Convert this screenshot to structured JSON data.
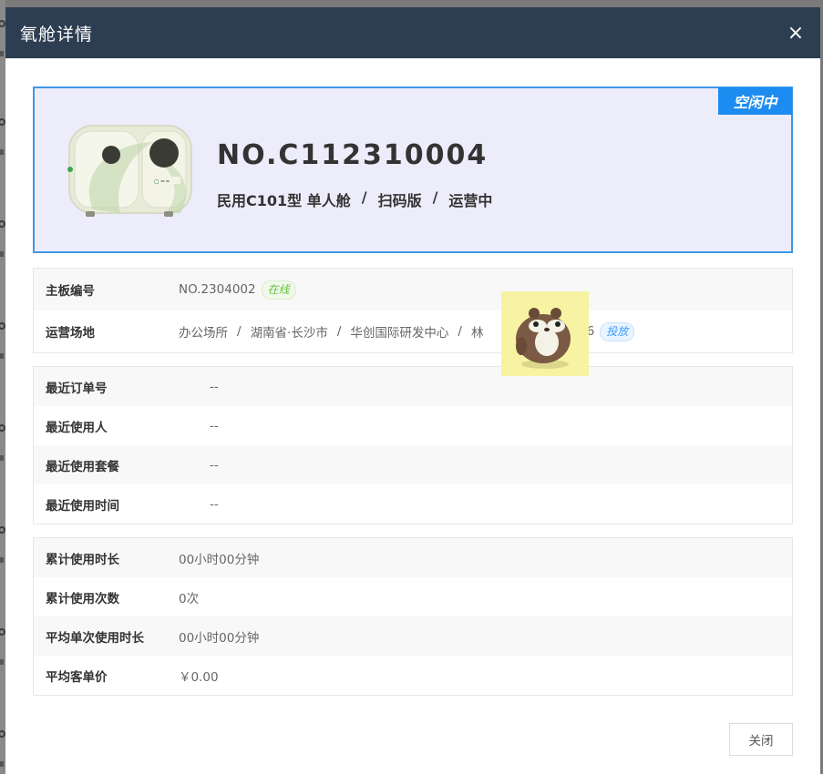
{
  "modal": {
    "title": "氧舱详情",
    "close_glyph": "×"
  },
  "hero": {
    "status_badge": "空闲中",
    "device_no": "NO.C112310004",
    "model": "民用C101型 单人舱",
    "mode": "扫码版",
    "state": "运营中",
    "separator": "/",
    "image_icon": "oxygen-chamber-device-image",
    "colors": {
      "badge": "#1d8cf0",
      "border": "#3d98e6",
      "background": "#edecfb"
    }
  },
  "basic": {
    "board": {
      "label": "主板编号",
      "value": "NO.2304002",
      "tag": "在线"
    },
    "site": {
      "label": "运营场地",
      "parts": [
        "办公场所",
        "湖南省·长沙市",
        "华创国际研发中心",
        "林"
      ],
      "tail": "846",
      "tag": "投放"
    }
  },
  "recent": [
    {
      "label": "最近订单号",
      "value": "--"
    },
    {
      "label": "最近使用人",
      "value": "--"
    },
    {
      "label": "最近使用套餐",
      "value": "--"
    },
    {
      "label": "最近使用时间",
      "value": "--"
    }
  ],
  "stats": [
    {
      "label": "累计使用时长",
      "value": "00小时00分钟"
    },
    {
      "label": "累计使用次数",
      "value": "0次"
    },
    {
      "label": "平均单次使用时长",
      "value": "00小时00分钟"
    },
    {
      "label": "平均客单价",
      "value": "￥0.00"
    }
  ],
  "footer": {
    "close_button": "关闭"
  },
  "overlay": {
    "icon": "hamster-sticker"
  }
}
